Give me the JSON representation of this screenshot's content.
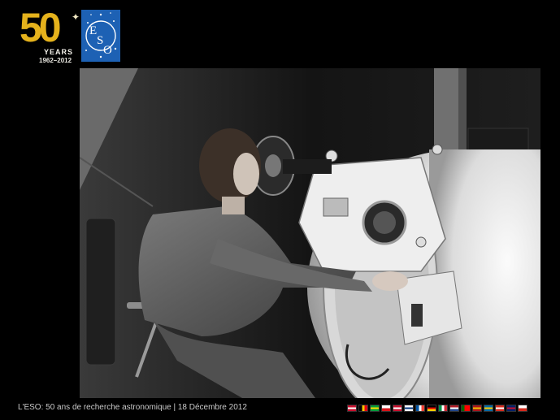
{
  "logo": {
    "number": "50",
    "years_label": "YEARS",
    "year_span": "1962–2012",
    "org_letters": [
      "E",
      "S",
      "O"
    ]
  },
  "photo": {
    "subject": "eso-telescope-operator-photo"
  },
  "footer": {
    "caption": "L'ESO: 50 ans de recherche  astronomique | 18 Décembre 2012"
  },
  "flags": [
    {
      "name": "austria-flag",
      "colors": [
        "#c8102e",
        "#ffffff",
        "#c8102e"
      ],
      "dir": "h"
    },
    {
      "name": "belgium-flag",
      "colors": [
        "#000000",
        "#f5c400",
        "#e30613"
      ],
      "dir": "v"
    },
    {
      "name": "brazil-flag",
      "colors": [
        "#009c3b",
        "#ffdf00",
        "#009c3b"
      ],
      "dir": "h"
    },
    {
      "name": "czech-flag",
      "colors": [
        "#ffffff",
        "#d7141a"
      ],
      "dir": "h"
    },
    {
      "name": "denmark-flag",
      "colors": [
        "#c8102e",
        "#ffffff",
        "#c8102e"
      ],
      "dir": "h"
    },
    {
      "name": "finland-flag",
      "colors": [
        "#ffffff",
        "#003580",
        "#ffffff"
      ],
      "dir": "h"
    },
    {
      "name": "france-flag",
      "colors": [
        "#0055a4",
        "#ffffff",
        "#ef4135"
      ],
      "dir": "v"
    },
    {
      "name": "germany-flag",
      "colors": [
        "#000000",
        "#dd0000",
        "#ffce00"
      ],
      "dir": "h"
    },
    {
      "name": "italy-flag",
      "colors": [
        "#009246",
        "#ffffff",
        "#ce2b37"
      ],
      "dir": "v"
    },
    {
      "name": "netherlands-flag",
      "colors": [
        "#ae1c28",
        "#ffffff",
        "#21468b"
      ],
      "dir": "h"
    },
    {
      "name": "portugal-flag",
      "colors": [
        "#006600",
        "#ff0000",
        "#ff0000"
      ],
      "dir": "v"
    },
    {
      "name": "spain-flag",
      "colors": [
        "#aa151b",
        "#f1bf00",
        "#aa151b"
      ],
      "dir": "h"
    },
    {
      "name": "sweden-flag",
      "colors": [
        "#006aa7",
        "#fecc00",
        "#006aa7"
      ],
      "dir": "h"
    },
    {
      "name": "switzerland-flag",
      "colors": [
        "#d52b1e",
        "#ffffff",
        "#d52b1e"
      ],
      "dir": "h"
    },
    {
      "name": "uk-flag",
      "colors": [
        "#012169",
        "#c8102e",
        "#012169"
      ],
      "dir": "h"
    },
    {
      "name": "chile-flag",
      "colors": [
        "#ffffff",
        "#d52b1e"
      ],
      "dir": "h"
    }
  ]
}
